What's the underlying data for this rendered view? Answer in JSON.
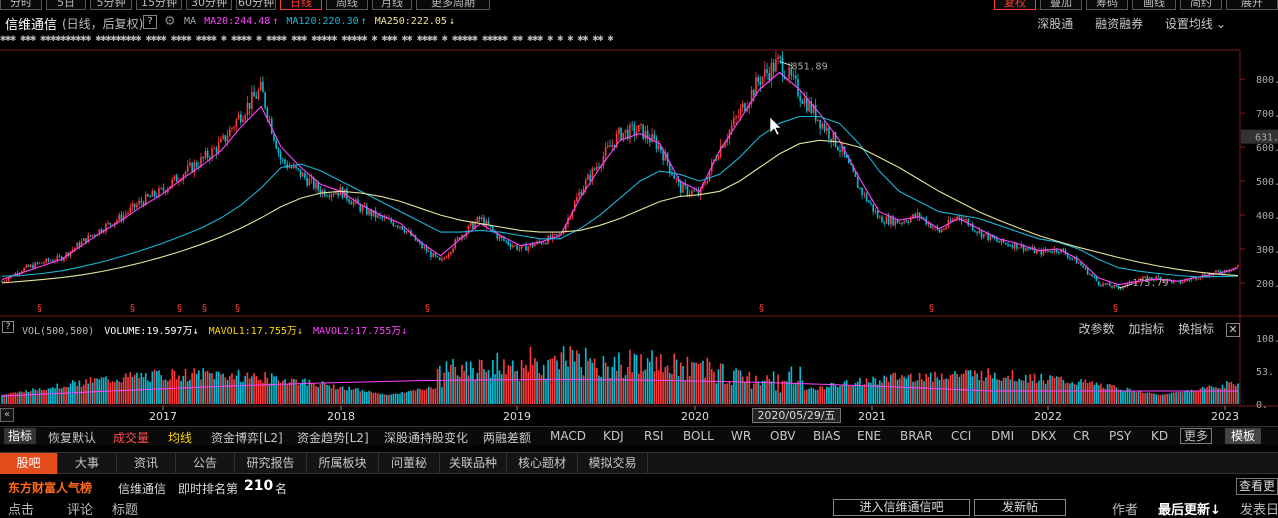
{
  "period_tabs": [
    {
      "label": "分时",
      "active": false
    },
    {
      "label": "5日",
      "active": false
    },
    {
      "label": "5分钟",
      "active": false
    },
    {
      "label": "15分钟",
      "active": false
    },
    {
      "label": "30分钟",
      "active": false
    },
    {
      "label": "60分钟",
      "active": false
    },
    {
      "label": "日线",
      "active": true
    },
    {
      "label": "周线",
      "active": false
    },
    {
      "label": "月线",
      "active": false
    },
    {
      "label": "更多周期",
      "active": false
    },
    {
      "label": "复权",
      "active": true
    },
    {
      "label": "叠加",
      "active": false
    },
    {
      "label": "筹码",
      "active": false
    },
    {
      "label": "画线",
      "active": false
    },
    {
      "label": "简约",
      "active": false
    },
    {
      "label": "展开",
      "active": false
    }
  ],
  "header": {
    "stock_name": "信维通信",
    "mode": "(日线，后复权)",
    "help": "?",
    "ma_label": "MA",
    "ma20": "MA20:244.48",
    "ma120": "MA120:220.30",
    "ma250": "MA250:222.05",
    "links": [
      "深股通",
      "融资融券",
      "设置均线"
    ]
  },
  "markers": "✱✱✱ ✱✱✱ ✱✱✱✱✱✱✱✱✱✱ ✱✱✱✱✱✱✱✱✱ ✱✱✱✱ ✱✱✱✱ ✱✱✱✱ ✱ ✱✱✱✱  ✱  ✱✱✱✱ ✱✱✱ ✱✱✱✱✱ ✱✱✱✱✱ ✱ ✱✱✱ ✱✱ ✱✱✱✱ ✱ ✱✱✱✱✱ ✱✱✱✱✱ ✱✱ ✱✱✱ ✱ ✱  ✱  ✱✱ ✱✱ ✱",
  "price_axis": {
    "ticks": [
      "800.",
      "700.",
      "600.",
      "500.",
      "400.",
      "300.",
      "200."
    ],
    "current_price": "631."
  },
  "chart_data": {
    "type": "line",
    "title": "信维通信 (日线，后复权)",
    "series": [
      {
        "name": "price",
        "values": [
          205,
          240,
          260,
          275,
          320,
          360,
          395,
          440,
          470,
          520,
          560,
          610,
          700,
          770,
          560,
          520,
          470,
          470,
          420,
          390,
          370,
          310,
          260,
          340,
          390,
          330,
          300,
          320,
          340,
          470,
          560,
          640,
          650,
          600,
          480,
          460,
          600,
          700,
          800,
          852,
          760,
          680,
          600,
          480,
          390,
          380,
          400,
          350,
          400,
          350,
          320,
          310,
          290,
          300,
          260,
          200,
          185,
          210,
          215,
          200,
          220,
          230,
          250
        ]
      },
      {
        "name": "MA20",
        "values": [
          210,
          230,
          250,
          270,
          310,
          350,
          385,
          425,
          460,
          505,
          545,
          590,
          660,
          720,
          600,
          540,
          490,
          470,
          430,
          400,
          375,
          320,
          280,
          330,
          375,
          340,
          310,
          320,
          340,
          450,
          540,
          620,
          640,
          610,
          500,
          470,
          590,
          680,
          770,
          820,
          770,
          700,
          620,
          510,
          410,
          385,
          395,
          360,
          390,
          360,
          330,
          315,
          295,
          300,
          270,
          215,
          195,
          205,
          212,
          205,
          218,
          228,
          244
        ]
      },
      {
        "name": "MA120",
        "values": [
          220,
          222,
          228,
          236,
          248,
          262,
          278,
          296,
          316,
          338,
          362,
          392,
          430,
          480,
          540,
          550,
          530,
          500,
          470,
          440,
          410,
          380,
          350,
          350,
          355,
          350,
          340,
          330,
          330,
          360,
          400,
          450,
          500,
          530,
          520,
          500,
          520,
          570,
          630,
          670,
          690,
          690,
          670,
          610,
          530,
          470,
          440,
          410,
          400,
          390,
          370,
          350,
          330,
          320,
          300,
          270,
          245,
          235,
          228,
          222,
          218,
          219,
          220
        ]
      },
      {
        "name": "MA250",
        "values": [
          200,
          205,
          210,
          216,
          224,
          234,
          246,
          260,
          276,
          294,
          314,
          336,
          362,
          392,
          425,
          450,
          465,
          470,
          465,
          455,
          440,
          420,
          400,
          385,
          375,
          365,
          355,
          350,
          350,
          355,
          370,
          390,
          415,
          440,
          455,
          460,
          470,
          500,
          540,
          580,
          610,
          620,
          615,
          600,
          570,
          540,
          505,
          470,
          440,
          410,
          385,
          362,
          340,
          322,
          305,
          290,
          275,
          262,
          250,
          240,
          232,
          226,
          222
        ]
      }
    ],
    "ylim": [
      150,
      880
    ],
    "annotations": [
      "851.89",
      "175.79"
    ],
    "years": [
      "2017",
      "2018",
      "2019",
      "2020",
      "2021",
      "2022",
      "2023"
    ],
    "grid": false
  },
  "volume": {
    "help": "?",
    "title": "VOL(500,500)",
    "volume": "VOLUME:19.597万",
    "mavol1": "MAVOL1:17.755万",
    "mavol2": "MAVOL2:17.755万",
    "tools": [
      "改参数",
      "加指标",
      "换指标"
    ],
    "close": "✕",
    "axis": [
      "108.",
      "53.",
      "0."
    ]
  },
  "date_tip": "2020/05/29/五",
  "indicators": {
    "first": "指标",
    "items": [
      "恢复默认",
      "成交量",
      "均线",
      "资金博弈[L2]",
      "资金趋势[L2]",
      "深股通持股变化",
      "两融差额",
      "MACD",
      "KDJ",
      "RSI",
      "BOLL",
      "WR",
      "OBV",
      "BIAS",
      "ENE",
      "BRAR",
      "CCI",
      "DMI",
      "DKX",
      "CR",
      "PSY",
      "KD"
    ],
    "more": "更多",
    "template": "模板"
  },
  "lower_tabs": [
    "股吧",
    "大事",
    "资讯",
    "公告",
    "研究报告",
    "所属板块",
    "问董秘",
    "关联品种",
    "核心题材",
    "模拟交易"
  ],
  "rank": {
    "brand": "东方财富人气榜",
    "name": "信维通信",
    "label": "即时排名第",
    "value": "210",
    "unit": "名",
    "view": "查看更"
  },
  "bottom": {
    "click": "点击",
    "comment": "评论",
    "title": "标题",
    "enter_btn": "进入信维通信吧",
    "post_btn": "发新帖",
    "author": "作者",
    "latest": "最后更新↓",
    "publish": "发表日"
  },
  "colors": {
    "up": "#ff3b3b",
    "down": "#00c0d8",
    "ma20": "#ff44ff",
    "ma120": "#19b5d8",
    "ma250": "#e8e49a",
    "accent": "#e54d1c"
  }
}
